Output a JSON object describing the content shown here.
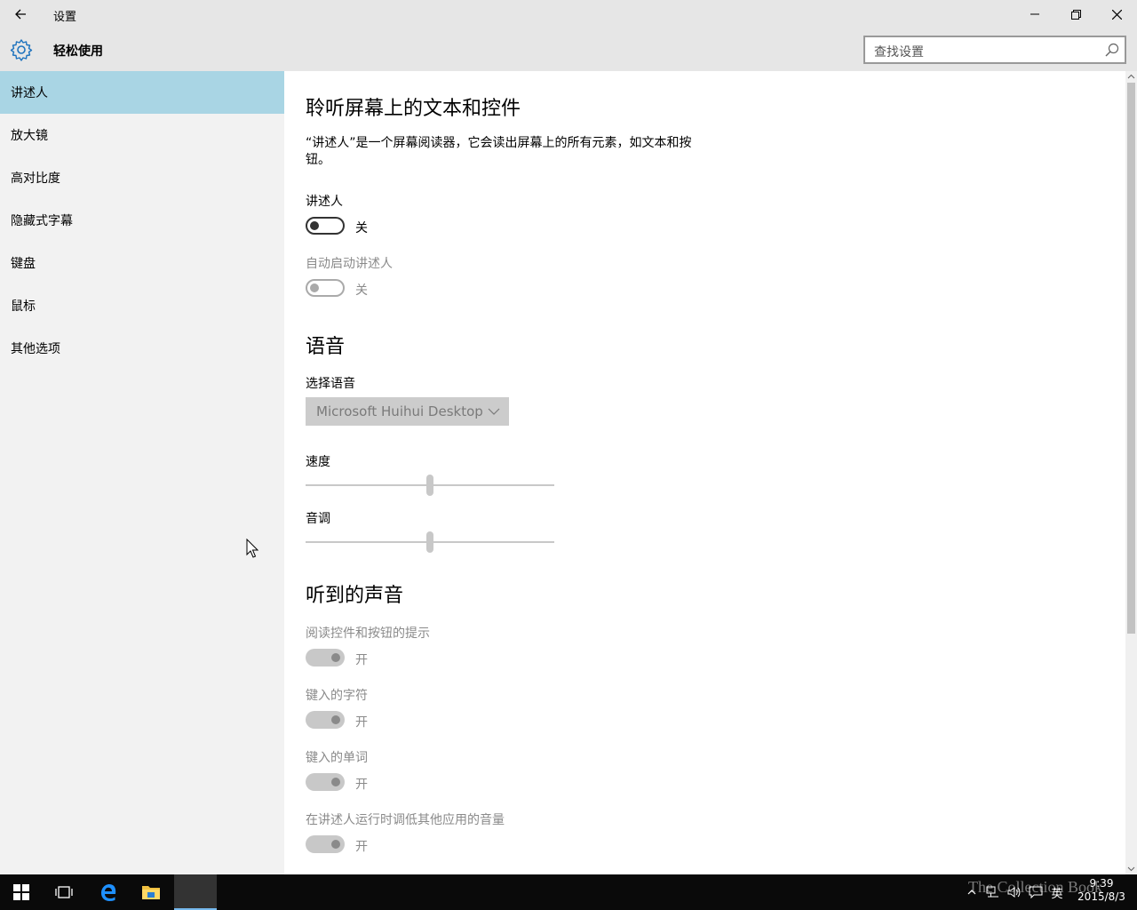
{
  "window": {
    "title": "设置",
    "section_title": "轻松使用"
  },
  "search": {
    "placeholder": "查找设置"
  },
  "sidebar": {
    "items": [
      {
        "label": "讲述人",
        "selected": true
      },
      {
        "label": "放大镜"
      },
      {
        "label": "高对比度"
      },
      {
        "label": "隐藏式字幕"
      },
      {
        "label": "键盘"
      },
      {
        "label": "鼠标"
      },
      {
        "label": "其他选项"
      }
    ]
  },
  "main": {
    "heading1": "聆听屏幕上的文本和控件",
    "description": "“讲述人”是一个屏幕阅读器，它会读出屏幕上的所有元素，如文本和按钮。",
    "narrator": {
      "label": "讲述人",
      "state": "关"
    },
    "auto_start": {
      "label": "自动启动讲述人",
      "state": "关"
    },
    "heading2": "语音",
    "voice": {
      "label": "选择语音",
      "value": "Microsoft Huihui Desktop"
    },
    "speed": {
      "label": "速度",
      "value_percent": 50
    },
    "pitch": {
      "label": "音调",
      "value_percent": 50
    },
    "heading3": "听到的声音",
    "hints": {
      "label": "阅读控件和按钮的提示",
      "state": "开"
    },
    "typed_chars": {
      "label": "键入的字符",
      "state": "开"
    },
    "typed_words": {
      "label": "键入的单词",
      "state": "开"
    },
    "lower_volume": {
      "label": "在讲述人运行时调低其他应用的音量",
      "state": "开"
    }
  },
  "taskbar": {
    "time": "9:39",
    "date": "2015/8/3",
    "ime": "英",
    "watermark": "The Collection Book"
  },
  "colors": {
    "selected_nav": "#a9d5e4",
    "accent": "#0078d7",
    "chrome": "#e6e6e6",
    "sidebar_bg": "#f2f2f2"
  }
}
